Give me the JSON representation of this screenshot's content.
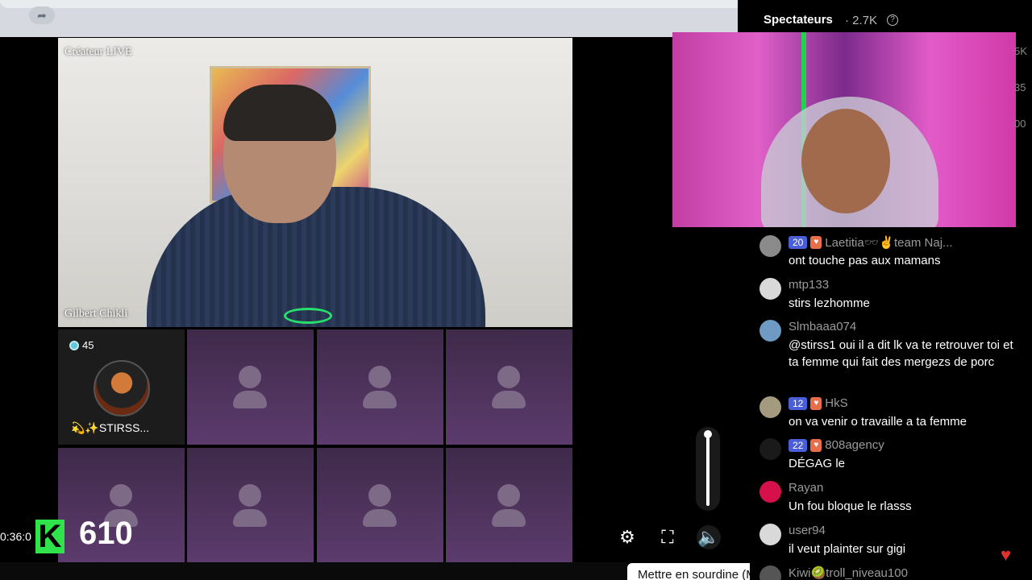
{
  "stream": {
    "host_label": "Créateur LIVE",
    "host_name": "Gilbert Chikli",
    "guest": {
      "badge_count": "45",
      "name": "💫✨STIRSS..."
    },
    "timer": "0:36:0",
    "score_logo": "K",
    "score": "610"
  },
  "controls": {
    "volume_level": 1.0,
    "tooltip": "Mettre en sourdine (M)"
  },
  "panel": {
    "title": "Spectateurs",
    "count": "· 2.7K",
    "edge_numbers": [
      "5K",
      "35",
      "00"
    ]
  },
  "chat": [
    {
      "user": "Laetitia🕶️✌️team Naj...",
      "level": "20",
      "has_heart": true,
      "text": "ont touche pas aux mamans",
      "avatar_color": "#8a8a8a"
    },
    {
      "user": "mtp133",
      "level": "",
      "has_heart": false,
      "text": "stirs lezhomme",
      "avatar_color": "#d9d9d9"
    },
    {
      "user": "Slmbaaa074",
      "level": "",
      "has_heart": false,
      "text": "@stirss1 oui il a dit lk va te retrouver toi et ta femme qui fait des mergezs de porc",
      "avatar_color": "#6e9ac4"
    },
    {
      "user": "HkS",
      "level": "12",
      "has_heart": true,
      "text": "on va venir o travaille a ta femme",
      "avatar_color": "#a39a80"
    },
    {
      "user": "808agency",
      "level": "22",
      "has_heart": true,
      "text": "DÉGAG le",
      "avatar_color": "#1a1a1a"
    },
    {
      "user": "Rayan",
      "level": "",
      "has_heart": false,
      "text": "Un fou bloque le rlasss",
      "avatar_color": "#d6104a"
    },
    {
      "user": "user94",
      "level": "",
      "has_heart": false,
      "text": "il veut plainter sur gigi",
      "avatar_color": "#d9d9d9"
    },
    {
      "user": "Kiwi🥝troll_niveau100",
      "level": "",
      "has_heart": false,
      "text": "",
      "avatar_color": "#555555"
    }
  ]
}
